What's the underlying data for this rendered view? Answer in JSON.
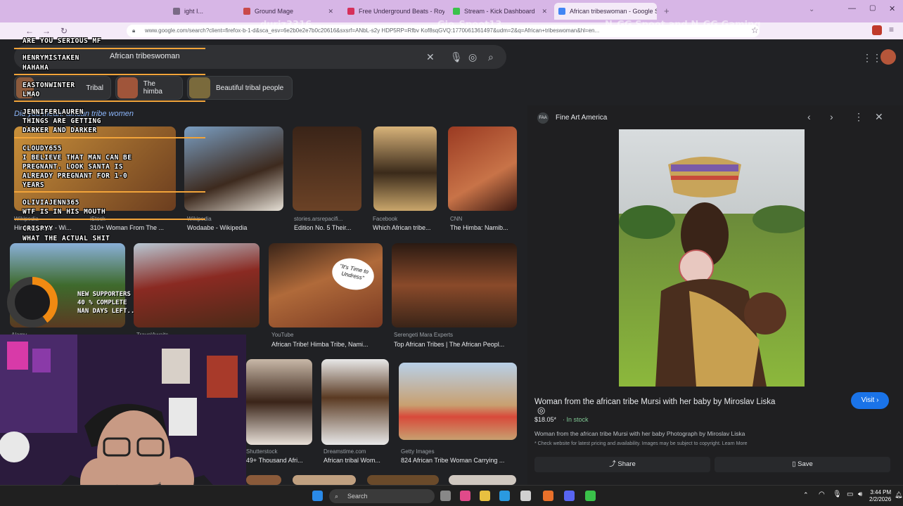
{
  "browser": {
    "tabs": [
      {
        "label": "ight I..."
      },
      {
        "label": "Ground Mage"
      },
      {
        "label": "Free Underground Beats - Royc"
      },
      {
        "label": "Stream - Kick Dashboard"
      },
      {
        "label": "African tribeswoman - Google S"
      }
    ],
    "url": "www.google.com/search?client=firefox-b-1-d&sca_esv=6e2b0e2e7b0c20616&sxsrf=ANbL-s2y HDP5RP=Rfbv Kof8sqGVQ:1770061361497&udm=2&q=African+tribeswoman&hl=en..."
  },
  "search": {
    "query": "African tribeswoman",
    "chips": [
      {
        "label": "Tribal"
      },
      {
        "label": "The himba"
      },
      {
        "label": "Beautiful tribal people"
      }
    ],
    "related_heading": "Did you mean: african tribe women"
  },
  "results": [
    {
      "source": "Wikipedia",
      "title": "Himba people - Wi..."
    },
    {
      "source": "iStock",
      "title": "310+ Woman From The ..."
    },
    {
      "source": "Wikipedia",
      "title": "Wodaabe - Wikipedia"
    },
    {
      "source": "stories.arsrepacifi...",
      "title": "Edition No. 5 Their..."
    },
    {
      "source": "Facebook",
      "title": "Which African tribe..."
    },
    {
      "source": "CNN",
      "title": "The Himba: Namib..."
    },
    {
      "source": "Alamy",
      "title": ""
    },
    {
      "source": "TravelAwaits",
      "title": ""
    },
    {
      "source": "YouTube",
      "title": "African Tribe! Himba Tribe, Nami..."
    },
    {
      "source": "Serengeti Mara Experts",
      "title": "Top African Tribes | The African Peopl..."
    },
    {
      "source": "Shutterstock",
      "title": "49+ Thousand Afri..."
    },
    {
      "source": "Dreamstime.com",
      "title": "African tribal Wom..."
    },
    {
      "source": "Getty Images",
      "title": "824 African Tribe Woman Carrying ..."
    }
  ],
  "speech_bubble": "\"It's Time to Undress\"",
  "panel": {
    "logo": "FAA",
    "site": "Fine Art America",
    "title": "Woman from the african tribe Mursi with her baby by Miroslav Liska",
    "visit": "Visit",
    "price": "$18.05*",
    "stock": "· In stock",
    "description": "Woman from the african tribe Mursi with her baby Photograph by Miroslav Liska",
    "note": "* Check website for latest pricing and availability. Images may be subject to copyright. Learn More",
    "share": "Share",
    "save": "Save"
  },
  "chat": [
    {
      "text": "ARE YOU SERIOUS MF"
    },
    {
      "text": "HENRYMISTAKEN"
    },
    {
      "text": "HAHAHA"
    },
    {
      "text": "EASTONWINTER"
    },
    {
      "text": "LMAO"
    },
    {
      "text": "JENNIFERLAUREN"
    },
    {
      "text": "THINGS ARE GETTING"
    },
    {
      "text": "DARKER AND DARKER"
    },
    {
      "text": "CLOUDY655"
    },
    {
      "text": "I BELIEVE THAT MAN CAN BE"
    },
    {
      "text": "PREGNANT. LOOK SANTA IS"
    },
    {
      "text": "ALREADY PREGNANT FOR 1-0"
    },
    {
      "text": "YEARS"
    },
    {
      "text": "OLIVIAJENN365"
    },
    {
      "text": "WTF IS IN HIS MOUTH"
    },
    {
      "text": "CRISPYY"
    },
    {
      "text": "WHAT THE ACTUAL SHIT"
    }
  ],
  "supporters": {
    "line1": "NEW SUPPORTERS",
    "line2": "40 % COMPLETE",
    "line3": "NAN DAYS LEFT..",
    "progress": 0.4,
    "color": "#f08a12"
  },
  "social": [
    "duriz3316",
    "Gio_Spoot13",
    "N_GG Spoot and N_GG Gaming"
  ],
  "taskbar": {
    "search": "Search",
    "time": "3:44 PM",
    "date": "2/2/2026"
  }
}
